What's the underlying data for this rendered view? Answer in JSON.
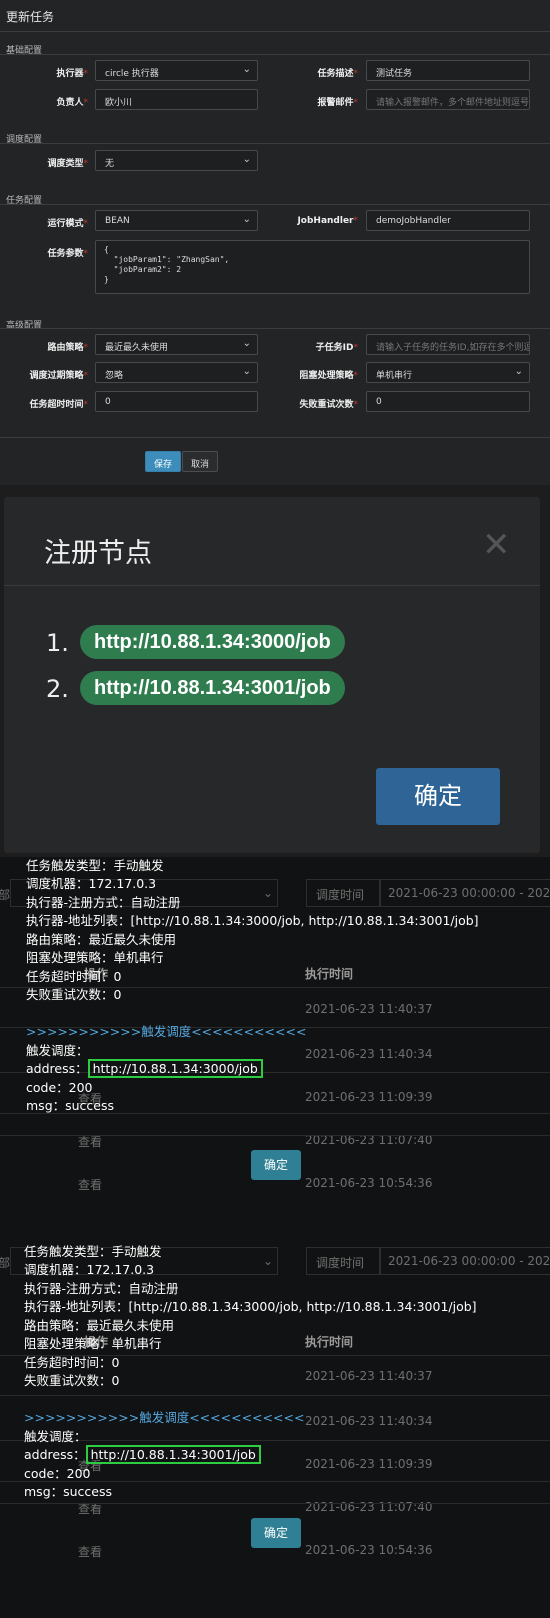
{
  "form": {
    "title": "更新任务",
    "sections": {
      "basic": "基础配置",
      "schedule": "调度配置",
      "task": "任务配置",
      "advanced": "高级配置"
    },
    "executor_label": "执行器",
    "executor_value": "circle 执行器",
    "desc_label": "任务描述",
    "desc_value": "测试任务",
    "owner_label": "负责人",
    "owner_value": "欧小川",
    "alarm_label": "报警邮件",
    "alarm_placeholder": "请输入报警邮件，多个邮件地址则逗号分",
    "sched_type_label": "调度类型",
    "sched_type_value": "无",
    "run_mode_label": "运行模式",
    "run_mode_value": "BEAN",
    "handler_label": "JobHandler",
    "handler_value": "demoJobHandler",
    "param_label": "任务参数",
    "param_value": "{\n  \"jobParam1\": \"ZhangSan\",\n  \"jobParam2\": 2\n}",
    "route_label": "路由策略",
    "route_value": "最近最久未使用",
    "child_label": "子任务ID",
    "child_placeholder": "请输入子任务的任务ID,如存在多个则逗",
    "expire_label": "调度过期策略",
    "expire_value": "忽略",
    "block_label": "阻塞处理策略",
    "block_value": "单机串行",
    "timeout_label": "任务超时时间",
    "timeout_value": "0",
    "retry_label": "失败重试次数",
    "retry_value": "0",
    "save_label": "保存",
    "cancel_label": "取消"
  },
  "nodes_modal": {
    "title": "注册节点",
    "close": "✕",
    "nodes": [
      {
        "num": "1.",
        "url": "http://10.88.1.34:3000/job"
      },
      {
        "num": "2.",
        "url": "http://10.88.1.34:3001/job"
      }
    ],
    "confirm": "确定"
  },
  "background_table": {
    "filter_left": "部",
    "filter_label": "调度时间",
    "filter_range": "2021-06-23 00:00:00 - 202",
    "col_op": "操作",
    "col_time": "执行时间",
    "view_label": "查看",
    "times": [
      "2021-06-23 11:40:37",
      "2021-06-23 11:40:34",
      "2021-06-23 11:09:39",
      "2021-06-23 11:07:40",
      "2021-06-23 10:54:36"
    ]
  },
  "logs": [
    {
      "lines": [
        "任务触发类型：手动触发",
        "调度机器：172.17.0.3",
        "执行器-注册方式：自动注册",
        "执行器-地址列表：[http://10.88.1.34:3000/job, http://10.88.1.34:3001/job]",
        "路由策略：最近最久未使用",
        "阻塞处理策略：单机串行",
        "任务超时时间：0",
        "失败重试次数：0"
      ],
      "trigger_header": ">>>>>>>>>>>触发调度<<<<<<<<<<<",
      "trigger_label": "触发调度：",
      "address_label": "address：",
      "address": "http://10.88.1.34:3000/job",
      "code": "code：200",
      "msg": "msg：success",
      "ok": "确定"
    },
    {
      "lines": [
        "任务触发类型：手动触发",
        "调度机器：172.17.0.3",
        "执行器-注册方式：自动注册",
        "执行器-地址列表：[http://10.88.1.34:3000/job, http://10.88.1.34:3001/job]",
        "路由策略：最近最久未使用",
        "阻塞处理策略：单机串行",
        "任务超时时间：0",
        "失败重试次数：0"
      ],
      "trigger_header": ">>>>>>>>>>>触发调度<<<<<<<<<<<",
      "trigger_label": "触发调度：",
      "address_label": "address：",
      "address": "http://10.88.1.34:3001/job",
      "code": "code：200",
      "msg": "msg：success",
      "ok": "确定"
    }
  ]
}
